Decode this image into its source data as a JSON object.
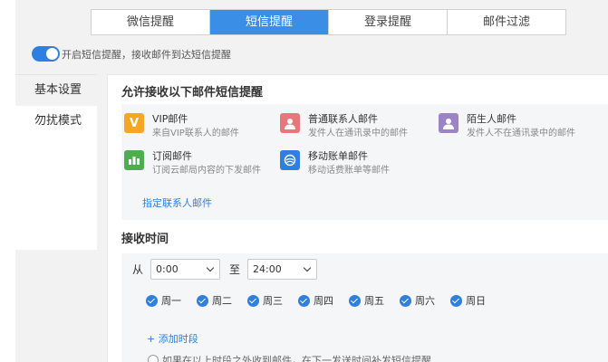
{
  "tabs": [
    {
      "label": "微信提醒",
      "active": false
    },
    {
      "label": "短信提醒",
      "active": true
    },
    {
      "label": "登录提醒",
      "active": false
    },
    {
      "label": "邮件过滤",
      "active": false
    }
  ],
  "toggle": {
    "on": true,
    "label": "开启短信提醒，接收邮件到达短信提醒"
  },
  "leftnav": {
    "items": [
      {
        "label": "基本设置",
        "active": true
      },
      {
        "label": "勿扰模式",
        "active": false
      }
    ]
  },
  "allow": {
    "title": "允许接收以下邮件短信提醒",
    "items": [
      {
        "title": "VIP邮件",
        "sub": "来自VIP联系人的邮件",
        "icon": "vip-icon",
        "glyph": "V",
        "color": "#f5a623"
      },
      {
        "title": "普通联系人邮件",
        "sub": "发件人在通讯录中的邮件",
        "icon": "contact-icon",
        "glyph": "",
        "color": "#e8767a"
      },
      {
        "title": "陌生人邮件",
        "sub": "发件人不在通讯录中的邮件",
        "icon": "stranger-icon",
        "glyph": "",
        "color": "#9b83c8"
      },
      {
        "title": "订阅邮件",
        "sub": "订阅云邮局内容的下发邮件",
        "icon": "subscribe-icon",
        "glyph": "",
        "color": "#4cae4f"
      },
      {
        "title": "移动账单邮件",
        "sub": "移动话费账单等邮件",
        "icon": "mobile-bill-icon",
        "glyph": "",
        "color": "#2f7fe0"
      }
    ],
    "link": "指定联系人邮件"
  },
  "receive": {
    "title": "接收时间",
    "from_label": "从",
    "from_value": "0:00",
    "to_label": "至",
    "to_value": "24:00",
    "days": [
      "周一",
      "周二",
      "周三",
      "周四",
      "周五",
      "周六",
      "周日"
    ],
    "add_label": "+ 添加时段",
    "radio_text": "如果在以上时段之外收到邮件，在下一发送时间补发短信提醒"
  }
}
